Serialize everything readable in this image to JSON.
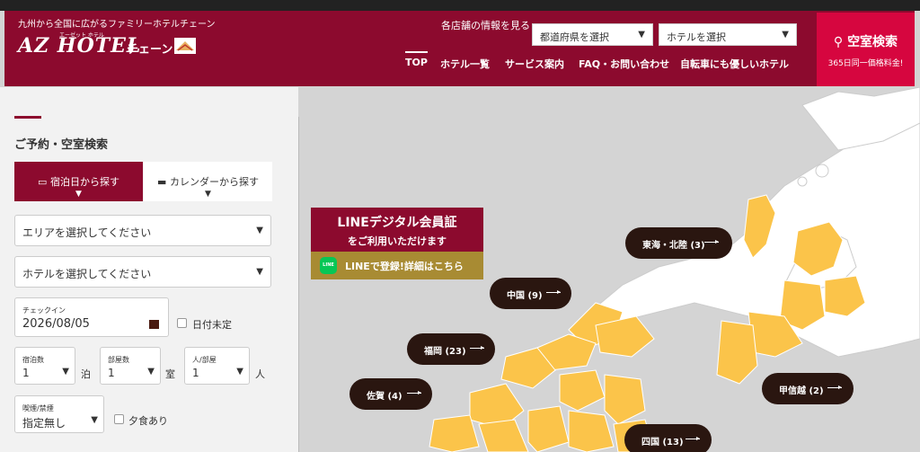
{
  "header": {
    "tagline": "九州から全国に広がるファミリーホテルチェーン",
    "logo_main": "AZ HOTEL",
    "logo_ruby": "エーゼット ホテル",
    "logo_chain": "チェーン",
    "store_info_label": "各店舗の情報を見る",
    "prefecture_select": "都道府県を選択",
    "hotel_select": "ホテルを選択",
    "nav": [
      "TOP",
      "ホテル一覧",
      "サービス案内",
      "FAQ・お問い合わせ",
      "自転車にも優しいホテル"
    ],
    "search_button": "空室検索",
    "search_sub": "365日同一価格料金!"
  },
  "booking": {
    "title": "ご予約・空室検索",
    "tab_date": "宿泊日から探す",
    "tab_calendar": "カレンダーから探す",
    "area_select": "エリアを選択してください",
    "hotel_select": "ホテルを選択してください",
    "checkin_label": "チェックイン",
    "checkin_value": "2026/08/05",
    "date_undecided": "日付未定",
    "nights_label": "宿泊数",
    "nights_value": "1",
    "nights_unit": "泊",
    "rooms_label": "部屋数",
    "rooms_value": "1",
    "rooms_unit": "室",
    "people_label": "人/部屋",
    "people_value": "1",
    "people_unit": "人",
    "smoking_label": "喫煙/禁煙",
    "smoking_value": "指定無し",
    "dinner_label": "夕食あり"
  },
  "banner": {
    "line1": "LINEデジタル会員証",
    "line2": "をご利用いただけます",
    "line3": "LINEで登録!詳細はこちら",
    "icon_text": "LINE"
  },
  "regions": [
    {
      "label": "東海・北陸 (3)"
    },
    {
      "label": "中国 (9)"
    },
    {
      "label": "福岡 (23)"
    },
    {
      "label": "佐賀 (4)"
    },
    {
      "label": "甲信越 (2)"
    },
    {
      "label": "四国 (13)"
    }
  ],
  "colors": {
    "brand": "#8c0a2e",
    "accent": "#d6063f",
    "map_region": "#fbc44a",
    "map_other": "#ffffff",
    "sea": "#d4d4d4",
    "pill": "#2a1610"
  }
}
